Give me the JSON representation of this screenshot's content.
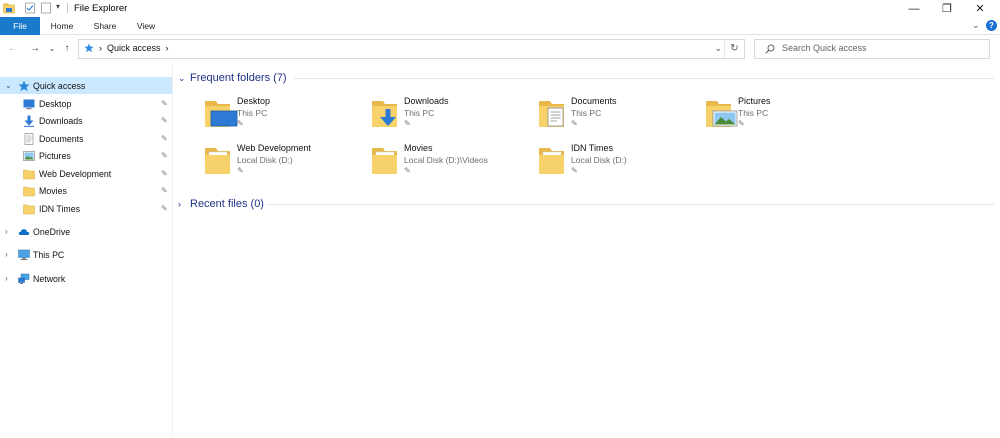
{
  "window": {
    "title": "File Explorer",
    "controls": {
      "minimize": "—",
      "maximize": "❐",
      "close": "✕"
    }
  },
  "ribbon": {
    "tabs": [
      {
        "label": "File"
      },
      {
        "label": "Home"
      },
      {
        "label": "Share"
      },
      {
        "label": "View"
      }
    ],
    "collapse_glyph": "⌄",
    "help_glyph": "?"
  },
  "nav": {
    "back": "←",
    "forward": "→",
    "recent": "⌄",
    "up": "↑",
    "breadcrumb": [
      "Quick access"
    ],
    "sep": "›",
    "dropdown": "⌄",
    "refresh": "↻"
  },
  "search": {
    "placeholder": "Search Quick access"
  },
  "sidebar": {
    "quick_access": {
      "label": "Quick access",
      "caret": "⌄"
    },
    "pinned": [
      {
        "label": "Desktop",
        "icon": "desktop-icon"
      },
      {
        "label": "Downloads",
        "icon": "downloads-icon"
      },
      {
        "label": "Documents",
        "icon": "documents-icon"
      },
      {
        "label": "Pictures",
        "icon": "pictures-icon"
      },
      {
        "label": "Web Development",
        "icon": "folder-icon"
      },
      {
        "label": "Movies",
        "icon": "folder-icon"
      },
      {
        "label": "IDN Times",
        "icon": "folder-icon"
      }
    ],
    "pin_glyph": "📌",
    "roots": [
      {
        "label": "OneDrive",
        "icon": "cloud-icon",
        "caret": "›"
      },
      {
        "label": "This PC",
        "icon": "computer-icon",
        "caret": "›"
      },
      {
        "label": "Network",
        "icon": "network-icon",
        "caret": "›"
      }
    ]
  },
  "main": {
    "frequent": {
      "title": "Frequent folders (7)",
      "caret": "⌄",
      "items": [
        {
          "name": "Desktop",
          "location": "This PC",
          "icon": "desktop-folder-icon"
        },
        {
          "name": "Downloads",
          "location": "This PC",
          "icon": "downloads-folder-icon"
        },
        {
          "name": "Documents",
          "location": "This PC",
          "icon": "documents-folder-icon"
        },
        {
          "name": "Pictures",
          "location": "This PC",
          "icon": "pictures-folder-icon"
        },
        {
          "name": "Web Development",
          "location": "Local Disk (D:)",
          "icon": "folder-icon"
        },
        {
          "name": "Movies",
          "location": "Local Disk (D:)\\Videos",
          "icon": "folder-icon"
        },
        {
          "name": "IDN Times",
          "location": "Local Disk (D:)",
          "icon": "folder-icon"
        }
      ]
    },
    "recent": {
      "title": "Recent files (0)",
      "caret": "›"
    }
  },
  "colors": {
    "accent": "#1979ca",
    "selected": "#cce8ff",
    "section_title": "#1e3287",
    "folder": "#f7d26b"
  }
}
